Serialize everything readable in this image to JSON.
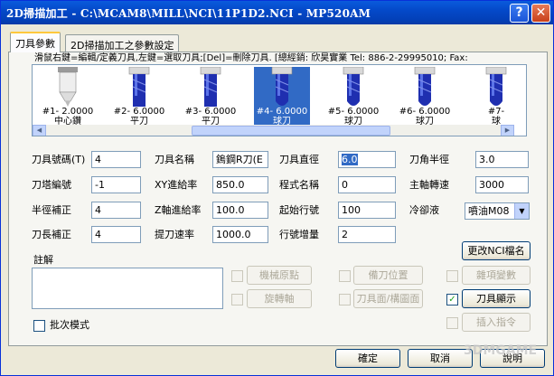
{
  "window": {
    "title": "2D掃描加工 - C:\\MCAM8\\MILL\\NCI\\11P1D2.NCI - MP520AM",
    "help_label": "?",
    "close_label": "✕"
  },
  "tabs": [
    {
      "label": "刀具參數",
      "active": true
    },
    {
      "label": "2D掃描加工之參數設定",
      "active": false
    }
  ],
  "hint": "滑鼠右鍵=編輯/定義刀具,左鍵=選取刀具;[Del]=刪除刀具. [總經銷: 欣昊實業 Tel: 886-2-29995010; Fax:",
  "tools": [
    {
      "line1": "#1- 2.0000",
      "line2": "中心鑽",
      "shape": "center-drill",
      "selected": false
    },
    {
      "line1": "#2- 6.0000",
      "line2": "平刀",
      "shape": "flat",
      "selected": false
    },
    {
      "line1": "#3- 6.0000",
      "line2": "平刀",
      "shape": "flat",
      "selected": false
    },
    {
      "line1": "#4- 6.0000",
      "line2": "球刀",
      "shape": "ball",
      "selected": true
    },
    {
      "line1": "#5- 6.0000",
      "line2": "球刀",
      "shape": "ball",
      "selected": false
    },
    {
      "line1": "#6- 6.0000",
      "line2": "球刀",
      "shape": "ball",
      "selected": false
    },
    {
      "line1": "#7- ",
      "line2": "球",
      "shape": "ball",
      "selected": false
    }
  ],
  "fields": {
    "tool_number": {
      "label": "刀具號碼(T)",
      "value": "4"
    },
    "tool_name": {
      "label": "刀具名稱",
      "value": "鎢鋼R刀(E"
    },
    "tool_diameter": {
      "label": "刀具直徑",
      "value": "6.0"
    },
    "corner_radius": {
      "label": "刀角半徑",
      "value": "3.0"
    },
    "turret_number": {
      "label": "刀塔編號",
      "value": "-1"
    },
    "xy_feed": {
      "label": "XY進給率",
      "value": "850.0"
    },
    "program_name": {
      "label": "程式名稱",
      "value": "0"
    },
    "spindle_speed": {
      "label": "主軸轉速",
      "value": "3000"
    },
    "radius_comp": {
      "label": "半徑補正",
      "value": "4"
    },
    "z_feed": {
      "label": "Z軸進給率",
      "value": "100.0"
    },
    "start_line": {
      "label": "起始行號",
      "value": "100"
    },
    "coolant": {
      "label": "冷卻液",
      "value": "噴油M08"
    },
    "length_comp": {
      "label": "刀長補正",
      "value": "4"
    },
    "retract_rate": {
      "label": "提刀速率",
      "value": "1000.0"
    },
    "line_increment": {
      "label": "行號增量",
      "value": "2"
    }
  },
  "buttons": {
    "rename_nci": "更改NCI檔名",
    "machine_origin": "機械原點",
    "rotary_axis": "旋轉軸",
    "tool_change_pos": "備刀位置",
    "tool_plane": "刀具面/構圖面",
    "misc_vars": "雜項變數",
    "tool_display": "刀具顯示",
    "insert_cmd": "插入指令",
    "ok": "確定",
    "cancel": "取消",
    "help": "說明"
  },
  "checks": {
    "machine_origin": false,
    "rotary_axis": false,
    "tool_change_pos": false,
    "tool_plane": false,
    "misc_vars": false,
    "tool_display": true,
    "insert_cmd": false,
    "batch_mode": false
  },
  "notes_label": "註解",
  "batch_label": "批次模式",
  "watermark": "3DMGAME 當游網"
}
